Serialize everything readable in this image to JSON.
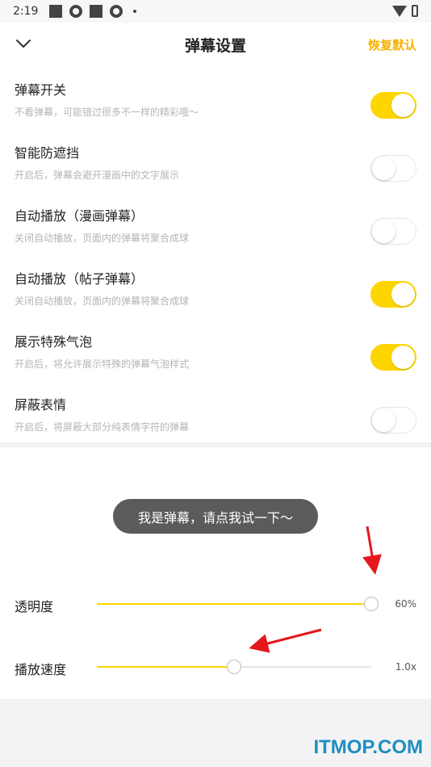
{
  "status_bar": {
    "time": "2:19"
  },
  "header": {
    "title": "弹幕设置",
    "restore_label": "恢复默认"
  },
  "settings": [
    {
      "title": "弹幕开关",
      "subtitle": "不看弹幕，可能错过很多不一样的精彩哦～",
      "on": true
    },
    {
      "title": "智能防遮挡",
      "subtitle": "开启后，弹幕会避开漫画中的文字展示",
      "on": false
    },
    {
      "title": "自动播放（漫画弹幕）",
      "subtitle": "关闭自动播放，页面内的弹幕将聚合成球",
      "on": false
    },
    {
      "title": "自动播放（帖子弹幕）",
      "subtitle": "关闭自动播放，页面内的弹幕将聚合成球",
      "on": true
    },
    {
      "title": "展示特殊气泡",
      "subtitle": "开启后，将允许展示特殊的弹幕气泡样式",
      "on": true
    },
    {
      "title": "屏蔽表情",
      "subtitle": "开启后，将屏蔽大部分纯表情字符的弹幕",
      "on": false
    }
  ],
  "preview": {
    "bubble_text": "我是弹幕，请点我试一下～"
  },
  "sliders": {
    "opacity": {
      "label": "透明度",
      "value_text": "60%",
      "fraction": 1.0
    },
    "speed": {
      "label": "播放速度",
      "value_text": "1.0x",
      "fraction": 0.5
    }
  },
  "colors": {
    "accent": "#ffd500",
    "restore": "#f5b300",
    "annotation": "#e3171c",
    "watermark": "#1e8fbf"
  },
  "watermark": "ITMOP.COM"
}
